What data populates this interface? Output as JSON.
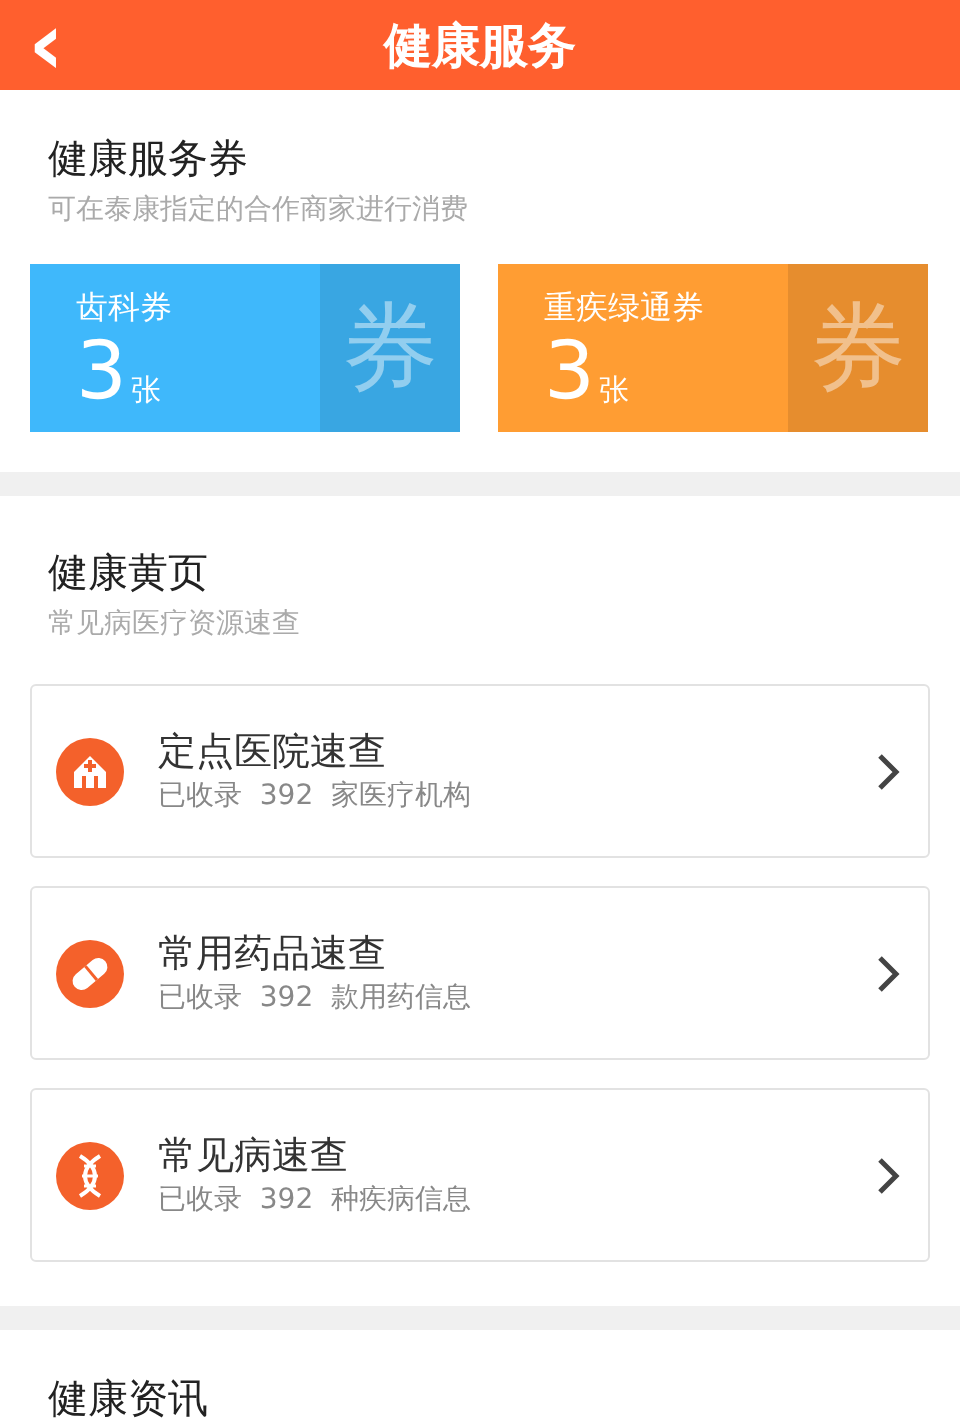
{
  "header": {
    "back_icon": "‹",
    "title": "健康服务"
  },
  "vouchers": {
    "title": "健康服务券",
    "subtitle": "可在泰康指定的合作商家进行消费",
    "items": [
      {
        "name": "齿科券",
        "count": "3",
        "unit": "张",
        "stamp": "券",
        "color": "#3fb8fb"
      },
      {
        "name": "重疾绿通券",
        "count": "3",
        "unit": "张",
        "stamp": "券",
        "color": "#ff9d33"
      }
    ]
  },
  "yellow_pages": {
    "title": "健康黄页",
    "subtitle": "常见病医疗资源速查",
    "items": [
      {
        "kind": "hospital",
        "title": "定点医院速查",
        "subtitle": "已收录  392  家医疗机构"
      },
      {
        "kind": "pill",
        "title": "常用药品速查",
        "subtitle": "已收录  392  款用药信息"
      },
      {
        "kind": "dna",
        "title": "常见病速查",
        "subtitle": "已收录  392  种疾病信息"
      }
    ]
  },
  "news": {
    "title": "健康资讯"
  }
}
